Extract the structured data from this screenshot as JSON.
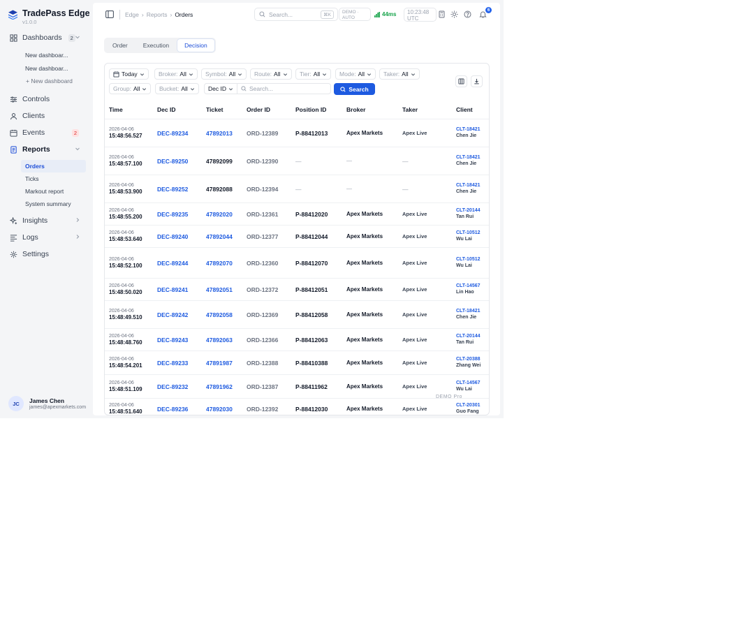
{
  "brand": {
    "name": "TradePass Edge",
    "version": "v1.0.0"
  },
  "sidebar": {
    "dashboards": {
      "label": "Dashboards",
      "count": "2",
      "items": [
        "New dashboar...",
        "New dashboar..."
      ],
      "add": "+ New dashboard"
    },
    "controls": "Controls",
    "clients": "Clients",
    "events": {
      "label": "Events",
      "count": "2"
    },
    "reports": {
      "label": "Reports",
      "items": [
        "Orders",
        "Ticks",
        "Markout report",
        "System summary"
      ]
    },
    "insights": "Insights",
    "logs": "Logs",
    "settings": "Settings"
  },
  "user": {
    "initials": "JC",
    "name": "James Chen",
    "email": "james@apexmarkets.com"
  },
  "topbar": {
    "breadcrumb": [
      "Edge",
      "Reports",
      "Orders"
    ],
    "search_placeholder": "Search...",
    "shortcut": "⌘K",
    "mode_line1": "DEMO ·",
    "mode_line2": "AUTO",
    "latency": "44ms",
    "time": "10:23:48",
    "timezone": "UTC",
    "notifications": "6"
  },
  "tabs": [
    "Order",
    "Execution",
    "Decision"
  ],
  "filters": {
    "date": "Today",
    "broker": {
      "label": "Broker:",
      "value": "All"
    },
    "symbol": {
      "label": "Symbol:",
      "value": "All"
    },
    "route": {
      "label": "Route:",
      "value": "All"
    },
    "tier": {
      "label": "Tier:",
      "value": "All"
    },
    "mode": {
      "label": "Mode:",
      "value": "All"
    },
    "taker": {
      "label": "Taker:",
      "value": "All"
    },
    "group": {
      "label": "Group:",
      "value": "All"
    },
    "bucket": {
      "label": "Bucket:",
      "value": "All"
    },
    "id_type": "Dec ID",
    "search_placeholder": "Search...",
    "search_button": "Search"
  },
  "table": {
    "columns": [
      "Time",
      "Dec ID",
      "Ticket",
      "Order ID",
      "Position ID",
      "Broker",
      "Taker",
      "Client"
    ],
    "rows": [
      {
        "date": "2026-04-06",
        "time": "15:48:56.527",
        "dec": "DEC-89234",
        "ticket": "47892013",
        "order": "ORD-12389",
        "position": "P-88412013",
        "broker": "Apex Markets",
        "taker": "Apex Live",
        "client_id": "CLT-18421",
        "client_name": "Chen Jie"
      },
      {
        "date": "2026-04-06",
        "time": "15:48:57.100",
        "dec": "DEC-89250",
        "ticket": "47892099",
        "order": "ORD-12390",
        "position": "—",
        "broker": "—",
        "taker": "—",
        "client_id": "CLT-18421",
        "client_name": "Chen Jie"
      },
      {
        "date": "2026-04-06",
        "time": "15:48:53.900",
        "dec": "DEC-89252",
        "ticket": "47892088",
        "order": "ORD-12394",
        "position": "—",
        "broker": "—",
        "taker": "—",
        "client_id": "CLT-18421",
        "client_name": "Chen Jie"
      },
      {
        "date": "2026-04-06",
        "time": "15:48:55.200",
        "dec": "DEC-89235",
        "ticket": "47892020",
        "order": "ORD-12361",
        "position": "P-88412020",
        "broker": "Apex Markets",
        "taker": "Apex Live",
        "client_id": "CLT-20144",
        "client_name": "Tan Rui"
      },
      {
        "date": "2026-04-06",
        "time": "15:48:53.640",
        "dec": "DEC-89240",
        "ticket": "47892044",
        "order": "ORD-12377",
        "position": "P-88412044",
        "broker": "Apex Markets",
        "taker": "Apex Live",
        "client_id": "CLT-10512",
        "client_name": "Wu Lai"
      },
      {
        "date": "2026-04-06",
        "time": "15:48:52.100",
        "dec": "DEC-89244",
        "ticket": "47892070",
        "order": "ORD-12360",
        "position": "P-88412070",
        "broker": "Apex Markets",
        "taker": "Apex Live",
        "client_id": "CLT-10512",
        "client_name": "Wu Lai"
      },
      {
        "date": "2026-04-06",
        "time": "15:48:50.020",
        "dec": "DEC-89241",
        "ticket": "47892051",
        "order": "ORD-12372",
        "position": "P-88412051",
        "broker": "Apex Markets",
        "taker": "Apex Live",
        "client_id": "CLT-14567",
        "client_name": "Lin Hao"
      },
      {
        "date": "2026-04-06",
        "time": "15:48:49.510",
        "dec": "DEC-89242",
        "ticket": "47892058",
        "order": "ORD-12369",
        "position": "P-88412058",
        "broker": "Apex Markets",
        "taker": "Apex Live",
        "client_id": "CLT-18421",
        "client_name": "Chen Jie"
      },
      {
        "date": "2026-04-06",
        "time": "15:48:48.760",
        "dec": "DEC-89243",
        "ticket": "47892063",
        "order": "ORD-12366",
        "position": "P-88412063",
        "broker": "Apex Markets",
        "taker": "Apex Live",
        "client_id": "CLT-20144",
        "client_name": "Tan Rui"
      },
      {
        "date": "2026-04-06",
        "time": "15:48:54.201",
        "dec": "DEC-89233",
        "ticket": "47891987",
        "order": "ORD-12388",
        "position": "P-88410388",
        "broker": "Apex Markets",
        "taker": "Apex Live",
        "client_id": "CLT-20388",
        "client_name": "Zhang Wei"
      },
      {
        "date": "2026-04-06",
        "time": "15:48:51.109",
        "dec": "DEC-89232",
        "ticket": "47891962",
        "order": "ORD-12387",
        "position": "P-88411962",
        "broker": "Apex Markets",
        "taker": "Apex Live",
        "client_id": "CLT-14567",
        "client_name": "Wu Lai"
      },
      {
        "date": "2026-04-06",
        "time": "15:48:51.640",
        "dec": "DEC-89236",
        "ticket": "47892030",
        "order": "ORD-12392",
        "position": "P-88412030",
        "broker": "Apex Markets",
        "taker": "Apex Live",
        "client_id": "CLT-20301",
        "client_name": "Guo Fang"
      }
    ]
  },
  "watermark": "DEMO Pro"
}
